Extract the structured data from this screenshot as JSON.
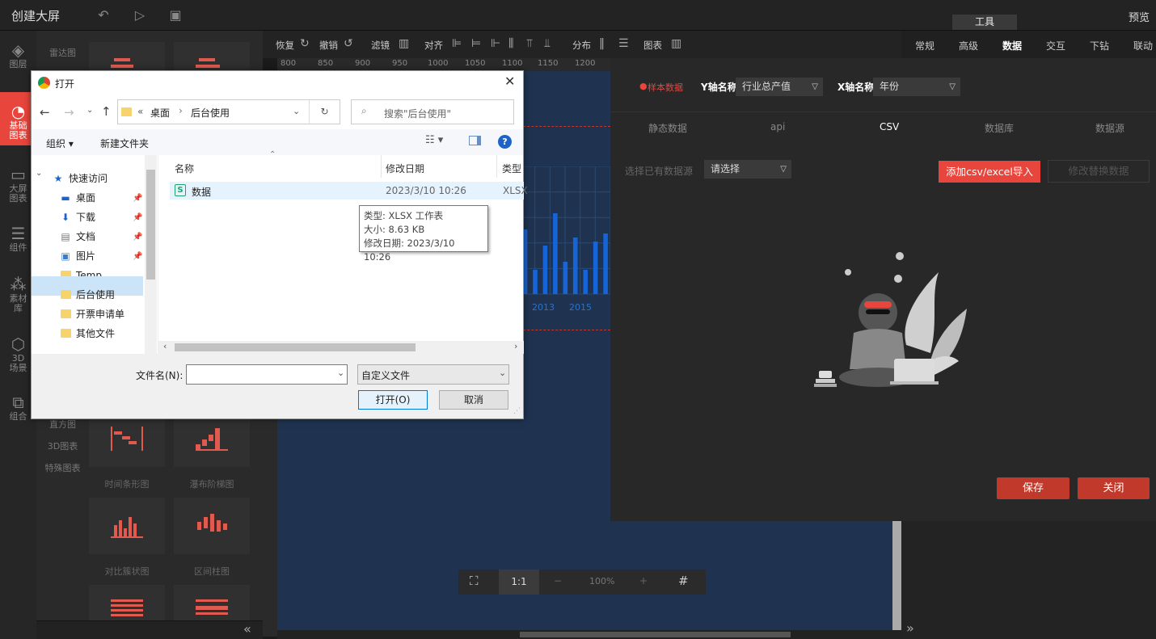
{
  "app": {
    "title": "创建大屏",
    "preview": "预览",
    "tool_tab": "工具"
  },
  "leftnav": [
    {
      "icon": "layers-icon",
      "label": "图层"
    },
    {
      "icon": "chart-pie-icon",
      "label": "基础图表"
    },
    {
      "icon": "monitor-chart-icon",
      "label": "大屏图表"
    },
    {
      "icon": "sliders-icon",
      "label": "组件"
    },
    {
      "icon": "material-icon",
      "label": "素材库"
    },
    {
      "icon": "cube-icon",
      "label": "3D场景"
    },
    {
      "icon": "group-icon",
      "label": "组合"
    }
  ],
  "categories": {
    "top": "雷达图",
    "c1": "直方图",
    "c2": "3D图表",
    "c3": "特殊图表"
  },
  "thumbs": {
    "t1": "时间条形图",
    "t2": "瀑布阶梯图",
    "t3": "对比簇状图",
    "t4": "区间柱图"
  },
  "toolbar": {
    "redo": "恢复",
    "undo": "撤销",
    "filter": "滤镜",
    "align": "对齐",
    "distribute": "分布",
    "chart": "图表"
  },
  "ruler": [
    "800",
    "850",
    "900",
    "950",
    "1000",
    "1050",
    "1100",
    "1150",
    "1200"
  ],
  "canvas": {
    "year1": "2013",
    "year2": "2015"
  },
  "chart_data": {
    "type": "bar",
    "categories": [
      "",
      "",
      "",
      "",
      "",
      "2013",
      "",
      "2015",
      ""
    ],
    "values": [
      80,
      30,
      60,
      100,
      40,
      70,
      30,
      65,
      75
    ],
    "title": "",
    "xlabel": "",
    "ylabel": ""
  },
  "zoom": {
    "oneone": "1:1",
    "level": "100%",
    "minus": "−",
    "plus": "+"
  },
  "rtabs": [
    "常规",
    "高级",
    "数据",
    "交互",
    "下钻",
    "联动"
  ],
  "data_panel": {
    "sample": "样本数据",
    "y_label": "Y轴名称",
    "y_value": "行业总产值",
    "x_label": "X轴名称",
    "x_value": "年份",
    "tabs": [
      "静态数据",
      "api",
      "CSV",
      "数据库",
      "数据源"
    ],
    "source_label": "选择已有数据源",
    "source_placeholder": "请选择",
    "import_btn": "添加csv/excel导入",
    "replace_btn": "修改替换数据",
    "save_btn": "保存",
    "close_btn": "关闭"
  },
  "dialog": {
    "title": "打开",
    "path_prefix": "«",
    "path1": "桌面",
    "path_sep": "›",
    "path2": "后台使用",
    "search_placeholder": "搜索\"后台使用\"",
    "organize": "组织 ▾",
    "new_folder": "新建文件夹",
    "tree": [
      {
        "label": "快速访问",
        "icon": "star-icon"
      },
      {
        "label": "桌面",
        "icon": "desktop-icon"
      },
      {
        "label": "下载",
        "icon": "download-icon"
      },
      {
        "label": "文档",
        "icon": "document-icon"
      },
      {
        "label": "图片",
        "icon": "picture-icon"
      },
      {
        "label": "Temp",
        "icon": "folder-icon"
      },
      {
        "label": "后台使用",
        "icon": "folder-icon"
      },
      {
        "label": "开票申请单",
        "icon": "folder-icon"
      },
      {
        "label": "其他文件",
        "icon": "folder-icon"
      }
    ],
    "col_name": "名称",
    "col_date": "修改日期",
    "col_type": "类型",
    "file_name": "数据",
    "file_date": "2023/3/10 10:26",
    "file_type": "XLSX",
    "tooltip_type": "类型: XLSX 工作表",
    "tooltip_size": "大小: 8.63 KB",
    "tooltip_date": "修改日期: 2023/3/10 10:26",
    "filename_label": "文件名(N):",
    "filter_value": "自定义文件",
    "open_btn": "打开(O)",
    "cancel_btn": "取消"
  }
}
